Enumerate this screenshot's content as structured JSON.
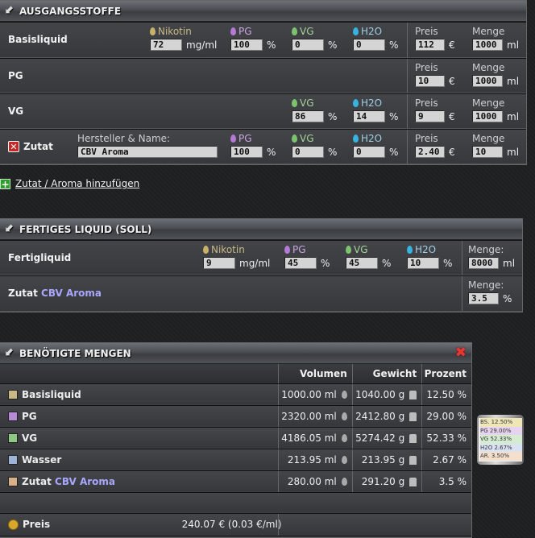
{
  "ausgangsstoffe": {
    "title": "AUSGANGSSTOFFE",
    "basisliquid": {
      "label": "Basisliquid",
      "nikotin_label": "Nikotin",
      "nikotin_value": "72",
      "nikotin_unit": "mg/ml",
      "pg_label": "PG",
      "pg_value": "100",
      "pg_unit": "%",
      "vg_label": "VG",
      "vg_value": "0",
      "vg_unit": "%",
      "h2o_label": "H2O",
      "h2o_value": "0",
      "h2o_unit": "%",
      "preis_label": "Preis",
      "preis_value": "112",
      "preis_unit": "€",
      "menge_label": "Menge",
      "menge_value": "1000",
      "menge_unit": "ml"
    },
    "pg": {
      "label": "PG",
      "preis_label": "Preis",
      "preis_value": "10",
      "preis_unit": "€",
      "menge_label": "Menge",
      "menge_value": "1000",
      "menge_unit": "ml"
    },
    "vg": {
      "label": "VG",
      "vg_label": "VG",
      "vg_value": "86",
      "vg_unit": "%",
      "h2o_label": "H2O",
      "h2o_value": "14",
      "h2o_unit": "%",
      "preis_label": "Preis",
      "preis_value": "9",
      "preis_unit": "€",
      "menge_label": "Menge",
      "menge_value": "1000",
      "menge_unit": "ml"
    },
    "zutat": {
      "remove_icon": "✕",
      "label": "Zutat",
      "hersteller_label": "Hersteller & Name:",
      "hersteller_value": "CBV Aroma",
      "pg_label": "PG",
      "pg_value": "100",
      "pg_unit": "%",
      "vg_label": "VG",
      "vg_value": "0",
      "vg_unit": "%",
      "h2o_label": "H2O",
      "h2o_value": "0",
      "h2o_unit": "%",
      "preis_label": "Preis",
      "preis_value": "2.40",
      "preis_unit": "€",
      "menge_label": "Menge",
      "menge_value": "10",
      "menge_unit": "ml"
    }
  },
  "add_link": {
    "icon": "+",
    "label": "Zutat / Aroma hinzufügen"
  },
  "fertiges": {
    "title": "FERTIGES LIQUID (SOLL)",
    "fertigliquid": {
      "label": "Fertigliquid",
      "nikotin_label": "Nikotin",
      "nikotin_value": "9",
      "nikotin_unit": "mg/ml",
      "pg_label": "PG",
      "pg_value": "45",
      "pg_unit": "%",
      "vg_label": "VG",
      "vg_value": "45",
      "vg_unit": "%",
      "h2o_label": "H2O",
      "h2o_value": "10",
      "h2o_unit": "%",
      "menge_label": "Menge:",
      "menge_value": "8000",
      "menge_unit": "ml"
    },
    "zutat": {
      "label_prefix": "Zutat",
      "label_name": "CBV Aroma",
      "menge_label": "Menge:",
      "menge_value": "3.5",
      "menge_unit": "%"
    }
  },
  "mengen": {
    "title": "BENÖTIGTE MENGEN",
    "close_icon": "✖",
    "headers": {
      "volumen": "Volumen",
      "gewicht": "Gewicht",
      "prozent": "Prozent"
    },
    "rows": [
      {
        "name": "Basisliquid",
        "name_suffix": "",
        "volumen": "1000.00 ml",
        "gewicht": "1040.00 g",
        "prozent": "12.50 %",
        "color": "#c9b886"
      },
      {
        "name": "PG",
        "name_suffix": "",
        "volumen": "2320.00 ml",
        "gewicht": "2412.80 g",
        "prozent": "29.00 %",
        "color": "#b68ad4"
      },
      {
        "name": "VG",
        "name_suffix": "",
        "volumen": "4186.05 ml",
        "gewicht": "5274.42 g",
        "prozent": "52.33 %",
        "color": "#8fc785"
      },
      {
        "name": "Wasser",
        "name_suffix": "",
        "volumen": "213.95 ml",
        "gewicht": "213.95 g",
        "prozent": "2.67 %",
        "color": "#9fb3d6"
      },
      {
        "name": "Zutat",
        "name_suffix": "CBV Aroma",
        "volumen": "280.00 ml",
        "gewicht": "291.20 g",
        "prozent": "3.5 %",
        "color": "#d8b08a"
      }
    ],
    "preis_label": "Preis",
    "preis_value": "240.07 € (0.03 €/ml)"
  },
  "bottle": {
    "lines": [
      "BS. 12.50%",
      "PG 29.00%",
      "VG 52.33%",
      "H2O 2.67%",
      "AR. 3.50%"
    ]
  }
}
